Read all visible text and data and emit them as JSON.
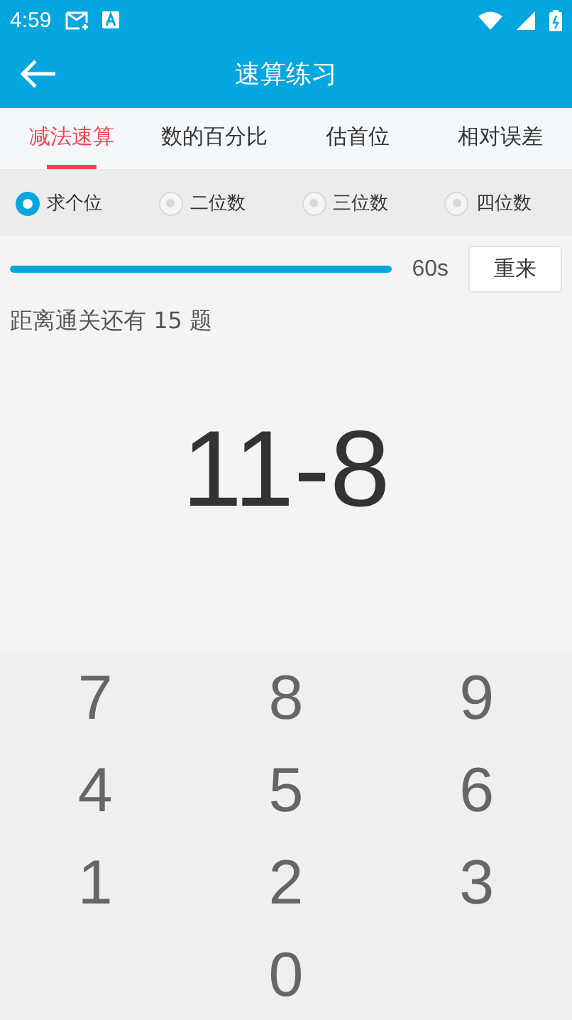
{
  "status_bar": {
    "time": "4:59"
  },
  "app_bar": {
    "title": "速算练习"
  },
  "tabs": [
    {
      "label": "减法速算",
      "selected": true
    },
    {
      "label": "数的百分比",
      "selected": false
    },
    {
      "label": "估首位",
      "selected": false
    },
    {
      "label": "相对误差",
      "selected": false
    }
  ],
  "options": [
    {
      "label": "求个位",
      "selected": true
    },
    {
      "label": "二位数",
      "selected": false
    },
    {
      "label": "三位数",
      "selected": false
    },
    {
      "label": "四位数",
      "selected": false
    }
  ],
  "timer": {
    "level": 1,
    "reading": "60s",
    "button": "重来"
  },
  "remaining": "距离通关还有 15 题",
  "question": "11-8",
  "keypad": [
    "7",
    "8",
    "9",
    "4",
    "5",
    "6",
    "1",
    "2",
    "3",
    "0"
  ]
}
